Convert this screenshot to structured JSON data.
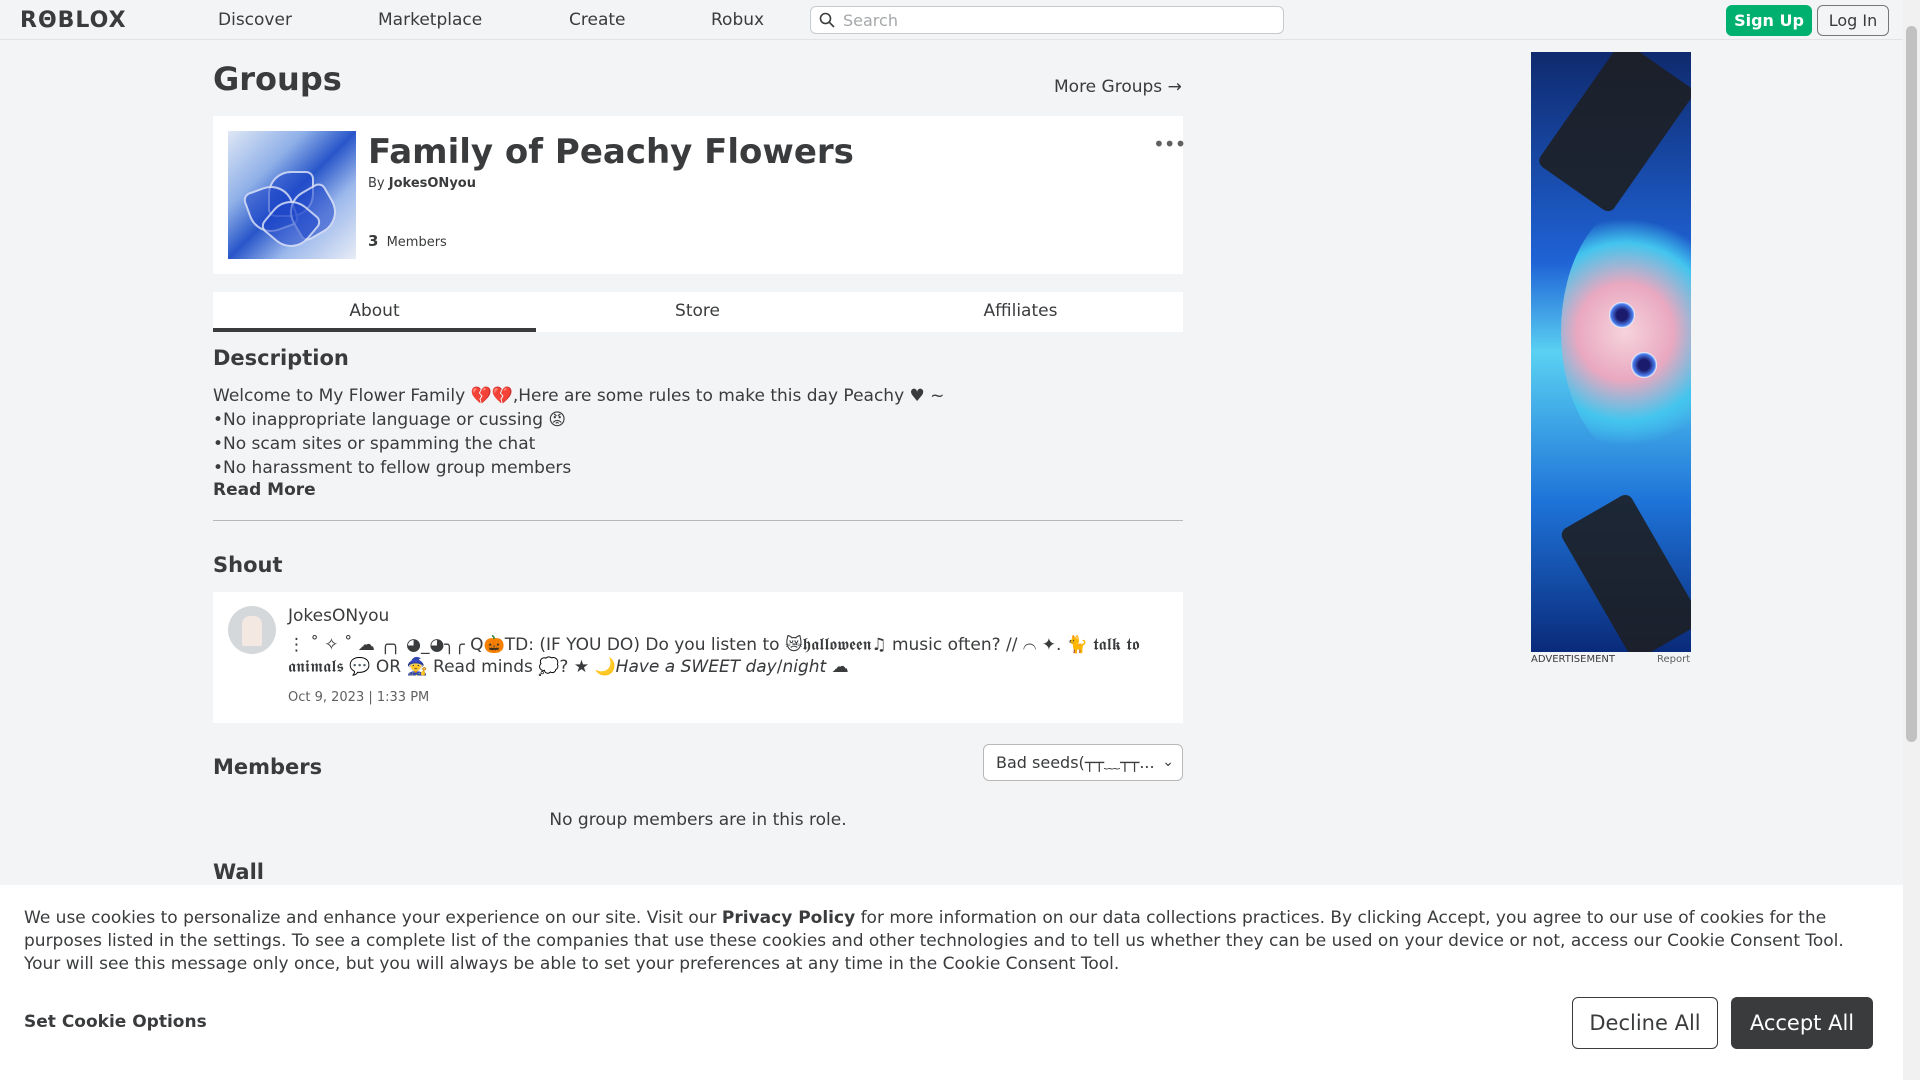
{
  "nav": {
    "logo": "RΘBLOX",
    "links": [
      "Discover",
      "Marketplace",
      "Create",
      "Robux"
    ],
    "search_placeholder": "Search",
    "signup_label": "Sign Up",
    "login_label": "Log In"
  },
  "page": {
    "title": "Groups",
    "more_groups": "More Groups →"
  },
  "group": {
    "name": "Family of Peachy Flowers",
    "by_label": "By",
    "owner": "JokesONyou",
    "member_count": "3",
    "members_label": "Members",
    "menu_icon": "ellipsis-icon"
  },
  "tabs": [
    "About",
    "Store",
    "Affiliates"
  ],
  "description": {
    "heading": "Description",
    "lines": [
      "Welcome to My Flower Family 💔💔,Here are some rules to make this day Peachy ♥ ~",
      "•No inappropriate language or cussing 😡",
      "•No scam sites or spamming the chat",
      "•No harassment to fellow group members"
    ],
    "read_more": "Read More"
  },
  "shout": {
    "heading": "Shout",
    "user": "JokesONyou",
    "text": "⋮ ˚ ✧ ˚ ☁ ╭╮ ◕_◕╮╭ Q🎃TD: (IF YOU DO) Do you listen to 😿𝖍𝖆𝖑𝖑𝖔𝖜𝖊𝖊𝖓♫ music often? // ⌒ ✦. 🐈 𝖙𝖆𝖑𝖐 𝖙𝖔 𝖆𝖓𝖎𝖒𝖆𝖑𝖘 💬 OR 🧙 Read minds 💭? ★ 🌙𝘏𝘢𝘷𝘦 𝘢 𝘚𝘞𝘌𝘌𝘛 𝘥𝘢𝘺/𝘯𝘪𝘨𝘩𝘵 ☁",
    "date": "Oct 9, 2023 | 1:33 PM"
  },
  "members": {
    "heading": "Members",
    "role_selected": "Bad seeds(┬┬﹏┬┬...",
    "empty_text": "No group members are in this role."
  },
  "wall": {
    "heading": "Wall"
  },
  "ad": {
    "label": "ADVERTISEMENT",
    "report": "Report"
  },
  "cookie": {
    "text_before": "We use cookies to personalize and enhance your experience on our site. Visit our ",
    "privacy_link": "Privacy Policy",
    "text_after": " for more information on our data collections practices. By clicking Accept, you agree to our use of cookies for the purposes listed in the settings. To see a complete list of the companies that use these cookies and other technologies and to tell us whether they can be used on your device or not, access our Cookie Consent Tool. Your will see this message only once, but you will always be able to set your preferences at any time in the Cookie Consent Tool.",
    "set_options": "Set Cookie Options",
    "decline": "Decline All",
    "accept": "Accept All"
  },
  "colors": {
    "accent_green": "#00b06f",
    "text": "#393b3d",
    "background": "#f2f4f5"
  }
}
